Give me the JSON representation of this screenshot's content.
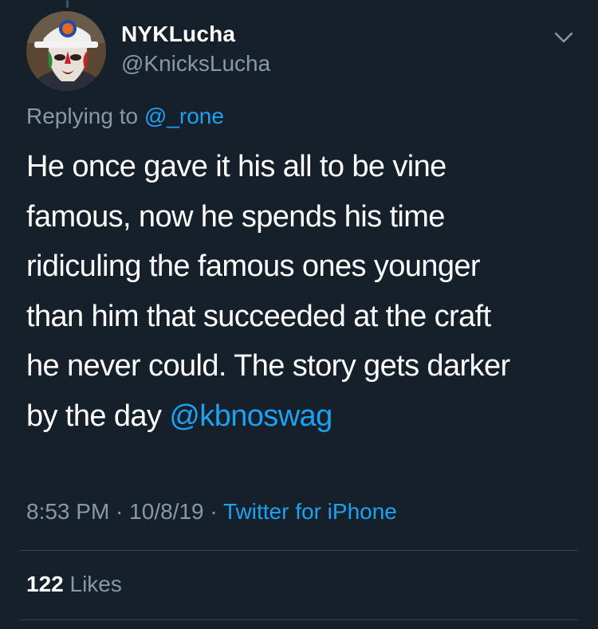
{
  "tweet": {
    "display_name": "NYKLucha",
    "handle": "@KnicksLucha",
    "replying_prefix": "Replying to ",
    "replying_to": "@_rone",
    "text_lines": [
      "He once gave it his all to be vine",
      "famous, now he spends his time",
      "ridiculing the famous ones younger",
      "than him that succeeded at the craft",
      "he never could. The story gets darker",
      "by the day "
    ],
    "text_mention": "@kbnoswag",
    "time": "8:53 PM",
    "separator": " · ",
    "date": "10/8/19",
    "source": "Twitter for iPhone",
    "likes_count": "122",
    "likes_label": " Likes"
  },
  "icons": {
    "menu": "chevron-down-icon",
    "avatar": "lucha-mask-avatar"
  },
  "colors": {
    "background": "#15202b",
    "accent": "#1da1f2",
    "secondary_text": "#8899a6",
    "primary_text": "#ffffff",
    "divider": "#38444d"
  }
}
